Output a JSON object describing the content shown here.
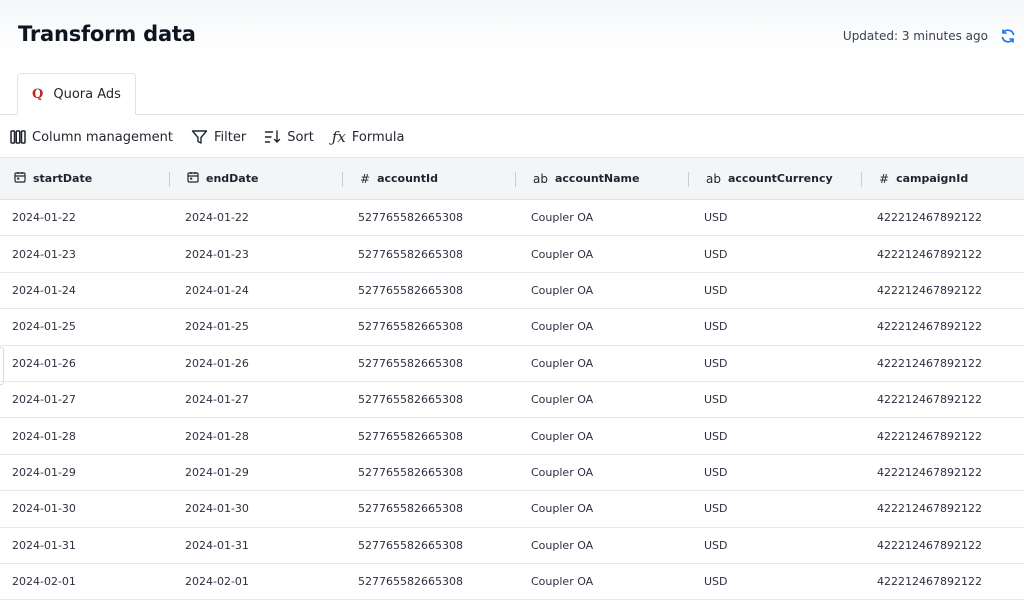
{
  "header": {
    "title": "Transform data",
    "updated_text": "Updated: 3 minutes ago"
  },
  "tabs": [
    {
      "label": "Quora Ads",
      "icon": "quora-icon",
      "icon_glyph": "Q",
      "active": true
    }
  ],
  "toolbar": {
    "column_management": "Column management",
    "filter": "Filter",
    "sort": "Sort",
    "formula": "Formula",
    "formula_glyph": "ƒx"
  },
  "table": {
    "columns": [
      {
        "name": "startDate",
        "type": "date",
        "type_glyph": ""
      },
      {
        "name": "endDate",
        "type": "date",
        "type_glyph": ""
      },
      {
        "name": "accountId",
        "type": "number",
        "type_glyph": "#"
      },
      {
        "name": "accountName",
        "type": "string",
        "type_glyph": "ab"
      },
      {
        "name": "accountCurrency",
        "type": "string",
        "type_glyph": "ab"
      },
      {
        "name": "campaignId",
        "type": "number",
        "type_glyph": "#"
      }
    ],
    "rows": [
      [
        "2024-01-22",
        "2024-01-22",
        "527765582665308",
        "Coupler OA",
        "USD",
        "422212467892122"
      ],
      [
        "2024-01-23",
        "2024-01-23",
        "527765582665308",
        "Coupler OA",
        "USD",
        "422212467892122"
      ],
      [
        "2024-01-24",
        "2024-01-24",
        "527765582665308",
        "Coupler OA",
        "USD",
        "422212467892122"
      ],
      [
        "2024-01-25",
        "2024-01-25",
        "527765582665308",
        "Coupler OA",
        "USD",
        "422212467892122"
      ],
      [
        "2024-01-26",
        "2024-01-26",
        "527765582665308",
        "Coupler OA",
        "USD",
        "422212467892122"
      ],
      [
        "2024-01-27",
        "2024-01-27",
        "527765582665308",
        "Coupler OA",
        "USD",
        "422212467892122"
      ],
      [
        "2024-01-28",
        "2024-01-28",
        "527765582665308",
        "Coupler OA",
        "USD",
        "422212467892122"
      ],
      [
        "2024-01-29",
        "2024-01-29",
        "527765582665308",
        "Coupler OA",
        "USD",
        "422212467892122"
      ],
      [
        "2024-01-30",
        "2024-01-30",
        "527765582665308",
        "Coupler OA",
        "USD",
        "422212467892122"
      ],
      [
        "2024-01-31",
        "2024-01-31",
        "527765582665308",
        "Coupler OA",
        "USD",
        "422212467892122"
      ],
      [
        "2024-02-01",
        "2024-02-01",
        "527765582665308",
        "Coupler OA",
        "USD",
        "422212467892122"
      ]
    ]
  },
  "colors": {
    "accent": "#1a73e8",
    "quora_brand": "#b92b27",
    "header_bg": "#f3f5f7"
  }
}
